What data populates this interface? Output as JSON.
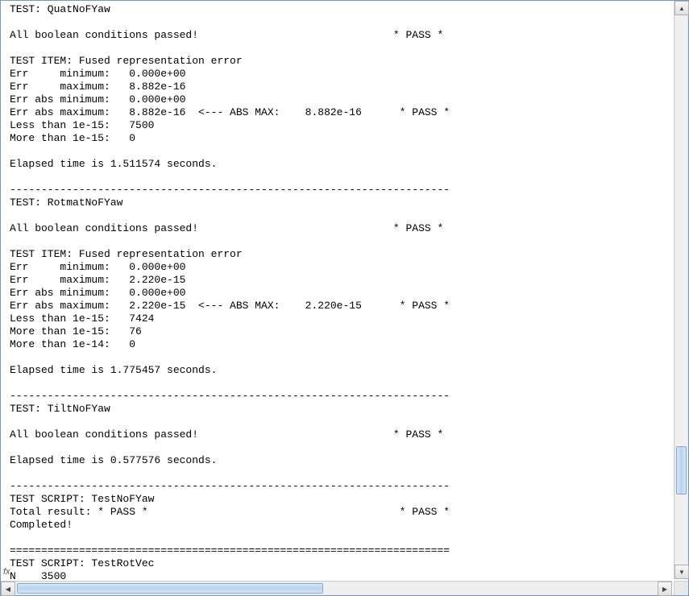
{
  "fx_label": "fx",
  "console": {
    "lines": [
      "TEST: QuatNoFYaw",
      "",
      "All boolean conditions passed!                               * PASS *",
      "",
      "TEST ITEM: Fused representation error",
      "Err     minimum:   0.000e+00",
      "Err     maximum:   8.882e-16",
      "Err abs minimum:   0.000e+00",
      "Err abs maximum:   8.882e-16  <--- ABS MAX:    8.882e-16      * PASS *",
      "Less than 1e-15:   7500",
      "More than 1e-15:   0",
      "",
      "Elapsed time is 1.511574 seconds.",
      "",
      "----------------------------------------------------------------------",
      "TEST: RotmatNoFYaw",
      "",
      "All boolean conditions passed!                               * PASS *",
      "",
      "TEST ITEM: Fused representation error",
      "Err     minimum:   0.000e+00",
      "Err     maximum:   2.220e-15",
      "Err abs minimum:   0.000e+00",
      "Err abs maximum:   2.220e-15  <--- ABS MAX:    2.220e-15      * PASS *",
      "Less than 1e-15:   7424",
      "More than 1e-15:   76",
      "More than 1e-14:   0",
      "",
      "Elapsed time is 1.775457 seconds.",
      "",
      "----------------------------------------------------------------------",
      "TEST: TiltNoFYaw",
      "",
      "All boolean conditions passed!                               * PASS *",
      "",
      "Elapsed time is 0.577576 seconds.",
      "",
      "----------------------------------------------------------------------",
      "TEST SCRIPT: TestNoFYaw",
      "Total result: * PASS *                                        * PASS *",
      "Completed!",
      "",
      "======================================================================",
      "TEST SCRIPT: TestRotVec",
      "N    3500"
    ]
  }
}
